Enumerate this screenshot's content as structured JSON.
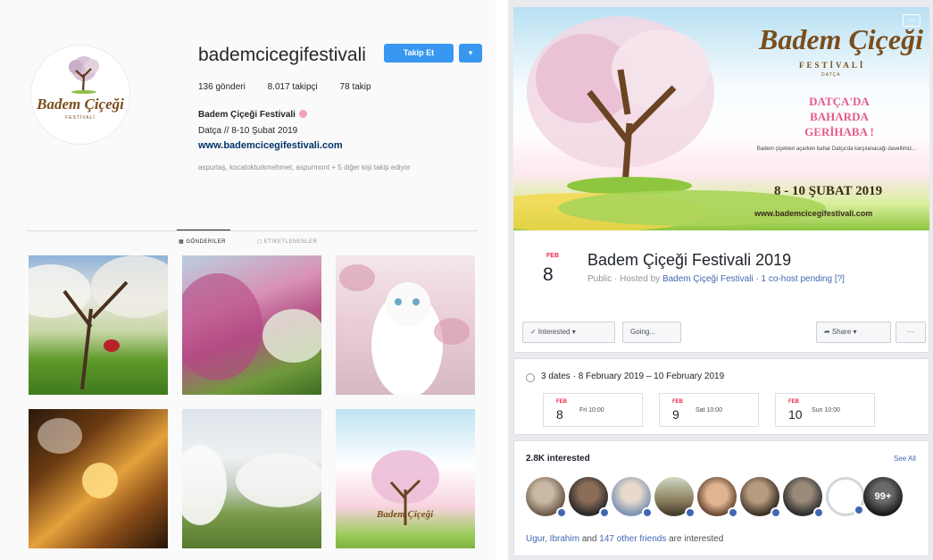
{
  "instagram": {
    "username": "bademcicegifestivali",
    "follow_label": "Takip Et",
    "dropdown_icon": "chevron-down-icon",
    "stats": {
      "posts": "136 gönderi",
      "followers": "8.017 takipçi",
      "following": "78 takip"
    },
    "bio": {
      "name": "Badem Çiçeği Festivali",
      "line": "Datça // 8-10 Şubat 2019",
      "link": "www.bademcicegifestivali.com"
    },
    "followed_by": "aspurtaş, kocatokturkmehmet, aspurmont + 5 diğer kişi takip ediyor",
    "tabs": {
      "posts": "Gönderiler",
      "tagged": "Etiketlenenler"
    },
    "avatar_logo": {
      "title": "Badem Çiçeği",
      "subtitle": "FESTİVALİ"
    },
    "grid": [
      "orchard-photo",
      "pink-blossom-photo",
      "white-kitten-photo",
      "sunset-blossom-photo",
      "orchard-rows-photo",
      "festival-poster-photo"
    ]
  },
  "facebook": {
    "cover": {
      "title": "Badem Çiçeği",
      "subtitle": "FESTİVALİ",
      "subtitle2": "DATÇA",
      "headline": "DATÇA'DA BAHARDA GERİHABA !",
      "description": "Badem çiçekleri açarken bahar Datça'da karşılanacağı davetlimiz...",
      "dates": "8 - 10 ŞUBAT 2019",
      "url": "www.bademcicegifestivali.com"
    },
    "event": {
      "month": "FEB",
      "day": "8",
      "title": "Badem Çiçeği Festivali 2019",
      "meta_prefix": "Public · Hosted by",
      "host": "Badem Çiçeği Festivali",
      "meta_suffix": "· 1 co-host pending [?]"
    },
    "buttons": {
      "interested": "✓ Interested ▾",
      "going": "Going...",
      "share": "➦ Share ▾",
      "more": "···"
    },
    "dates_summary": "3 dates · 8 February 2019 – 10 February 2019",
    "date_cards": [
      {
        "month": "FEB",
        "day": "8",
        "time": "Fri 10:00"
      },
      {
        "month": "FEB",
        "day": "9",
        "time": "Sat 10:00"
      },
      {
        "month": "FEB",
        "day": "10",
        "time": "Sun 10:00"
      }
    ],
    "interested_count": "2.8K interested",
    "see_all": "See All",
    "friends_names": "Ugur, Ibrahim",
    "friends_and": "and",
    "friends_others": "147 other friends",
    "friends_suffix": "are interested",
    "last_avatar_badge": "99+"
  },
  "colors": {
    "instagram_blue": "#3897f0",
    "facebook_blue": "#4267b2",
    "facebook_red": "#f02849",
    "logo_brown": "#7a4d1c",
    "blossom_pink": "#e45a8a"
  }
}
